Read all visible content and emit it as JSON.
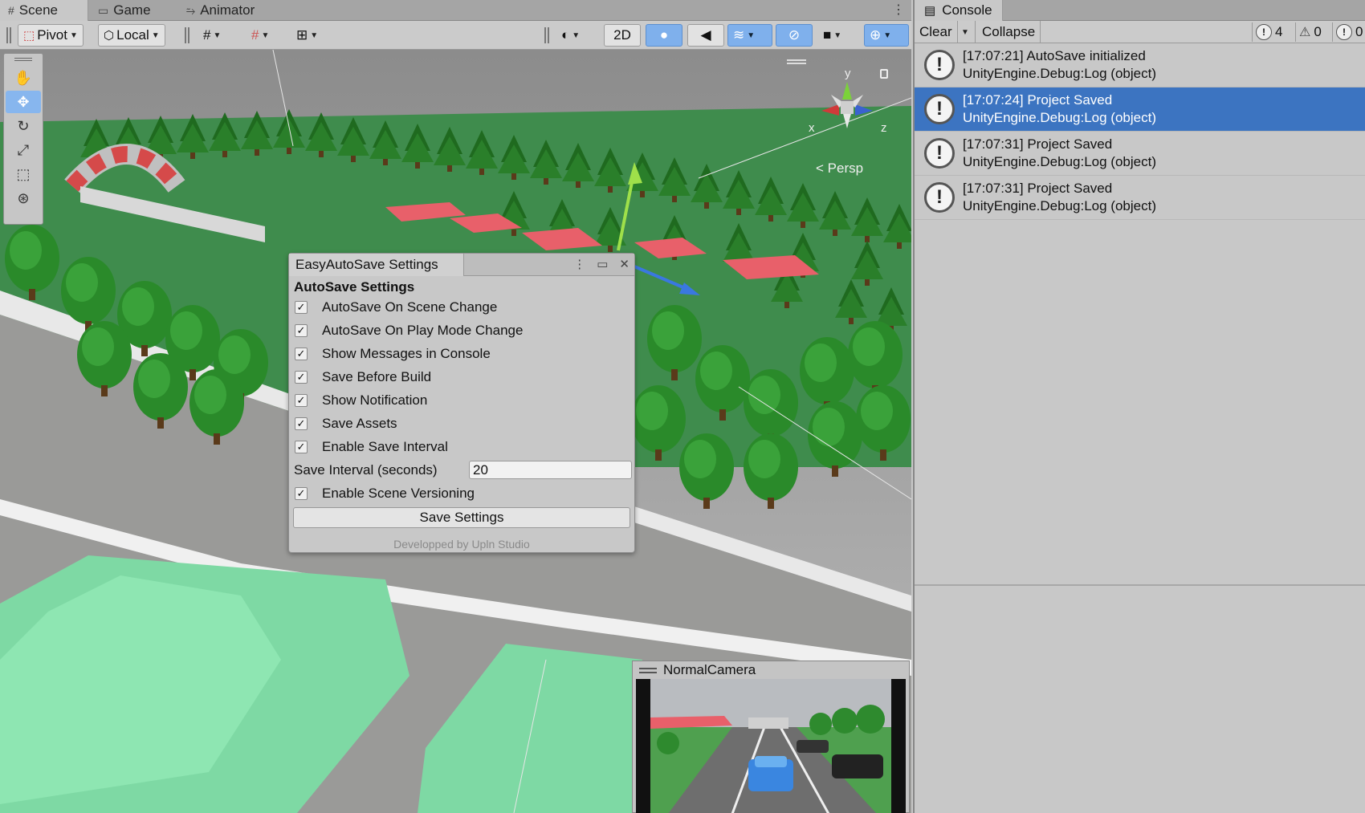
{
  "scene_tabs": [
    {
      "label": "Scene",
      "icon": "grid-icon"
    },
    {
      "label": "Game",
      "icon": "gamepad-icon"
    },
    {
      "label": "Animator",
      "icon": "animator-icon"
    }
  ],
  "toolbar": {
    "pivot_label": "Pivot",
    "local_label": "Local",
    "mode_2d_label": "2D"
  },
  "tools": [
    "hand-tool",
    "move-tool",
    "rotate-tool",
    "scale-tool",
    "rect-tool",
    "transform-tool"
  ],
  "gizmo": {
    "y_label": "y",
    "x_label": "x",
    "z_label": "z",
    "view_label": "< Persp"
  },
  "settings_window": {
    "title": "EasyAutoSave Settings",
    "heading": "AutoSave Settings",
    "options_a": [
      {
        "label": "AutoSave On Scene Change",
        "checked": true
      },
      {
        "label": "AutoSave On Play Mode Change",
        "checked": true
      },
      {
        "label": "Show Messages in Console",
        "checked": true
      },
      {
        "label": "Save Before Build",
        "checked": true
      },
      {
        "label": "Show Notification",
        "checked": true
      },
      {
        "label": "Save Assets",
        "checked": true
      },
      {
        "label": "Enable Save Interval",
        "checked": true
      }
    ],
    "interval_label": "Save Interval (seconds)",
    "interval_value": "20",
    "versioning": {
      "label": "Enable Scene Versioning",
      "checked": true
    },
    "save_button": "Save Settings",
    "footer": "Developped by Upln Studio"
  },
  "camera_preview": {
    "title": "NormalCamera"
  },
  "console": {
    "tab_label": "Console",
    "clear_label": "Clear",
    "collapse_label": "Collapse",
    "counts": {
      "info": "4",
      "warning": "0",
      "error": "0"
    },
    "entries": [
      {
        "line1": "[17:07:21] AutoSave initialized",
        "line2": "UnityEngine.Debug:Log (object)",
        "selected": false
      },
      {
        "line1": "[17:07:24] Project Saved",
        "line2": "UnityEngine.Debug:Log (object)",
        "selected": true
      },
      {
        "line1": "[17:07:31] Project Saved",
        "line2": "UnityEngine.Debug:Log (object)",
        "selected": false
      },
      {
        "line1": "[17:07:31] Project Saved",
        "line2": "UnityEngine.Debug:Log (object)",
        "selected": false
      }
    ]
  },
  "colors": {
    "selection": "#3c74c1",
    "accent": "#7fb0ec",
    "tree": "#2f7d2f",
    "tent": "#e8606a"
  }
}
